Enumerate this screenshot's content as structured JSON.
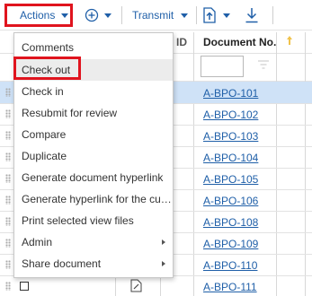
{
  "toolbar": {
    "actions_label": "Actions",
    "transmit_label": "Transmit"
  },
  "table": {
    "document_no_header": "Document No.",
    "rows": [
      "A-BPO-101",
      "A-BPO-102",
      "A-BPO-103",
      "A-BPO-104",
      "A-BPO-105",
      "A-BPO-106",
      "A-BPO-108",
      "A-BPO-109",
      "A-BPO-110",
      "A-BPO-111"
    ]
  },
  "menu": {
    "items": [
      "Comments",
      "Check out",
      "Check in",
      "Resubmit for review",
      "Compare",
      "Duplicate",
      "Generate document hyperlink",
      "Generate hyperlink for the current r...",
      "Print selected view files",
      "Admin",
      "Share document"
    ]
  },
  "colors": {
    "accent": "#1f5fa8",
    "highlight_red": "#e0141e",
    "selected_row": "#cfe2f7",
    "menu_hover": "#ececec",
    "sort_arrow": "#f0c24a"
  }
}
